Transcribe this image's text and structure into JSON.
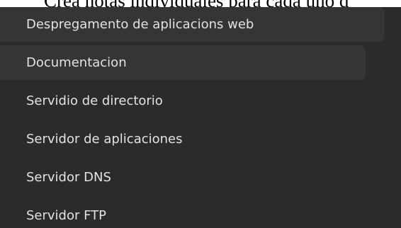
{
  "background_text": "Crea notas individuales para cada uno d",
  "menu": {
    "items": [
      {
        "label": "Despregamento de aplicacions web"
      },
      {
        "label": "Documentacion"
      },
      {
        "label": "Servidio de directorio"
      },
      {
        "label": "Servidor de aplicaciones"
      },
      {
        "label": "Servidor DNS"
      },
      {
        "label": "Servidor FTP"
      }
    ]
  },
  "colors": {
    "panel_bg": "#2b2b2b",
    "item_highlight_bg": "#353535",
    "item_text": "#e2e2e2"
  }
}
